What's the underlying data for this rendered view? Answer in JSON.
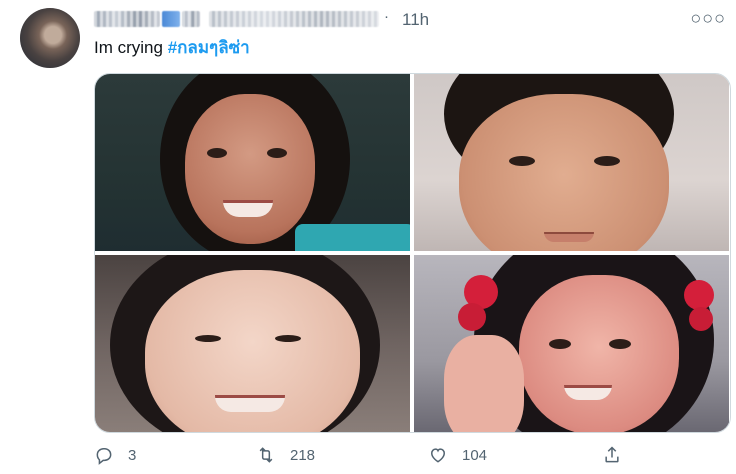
{
  "tweet": {
    "time": "11h",
    "text_prefix": "Im crying ",
    "hashtag": "#กลมๆลิซ่า",
    "more_glyph": "○○○",
    "dot_glyph": "·"
  },
  "actions": {
    "reply_count": "3",
    "retweet_count": "218",
    "like_count": "104"
  },
  "colors": {
    "hashtag": "#1d9bf0",
    "secondary_text": "#536471"
  },
  "icons": [
    "reply-icon",
    "retweet-icon",
    "like-icon",
    "share-icon",
    "more-icon"
  ]
}
